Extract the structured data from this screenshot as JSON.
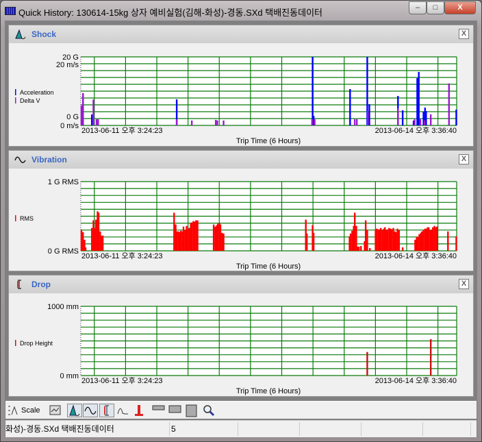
{
  "window": {
    "title": "Quick History: 130614-15kg 상자 예비실험(김해-화성)-경동.SXd 택배진동데이터",
    "minimize": "‒",
    "maximize": "□",
    "close": "X"
  },
  "panels": {
    "shock": {
      "title": "Shock",
      "close": "X",
      "icon": "shock-peak-icon"
    },
    "vibration": {
      "title": "Vibration",
      "close": "X",
      "icon": "sine-wave-icon"
    },
    "drop": {
      "title": "Drop",
      "close": "X",
      "icon": "drop-bracket-icon"
    }
  },
  "toolbar": {
    "scale_label": "Scale"
  },
  "status": {
    "file": "화성)-경동.SXd 택배진동데이터",
    "count": "5"
  },
  "chart_data": [
    {
      "type": "bar",
      "id": "shock",
      "xlabel": "Trip Time (6 Hours)",
      "x_start_label": "2013-06-11 오후 3:24:23",
      "x_end_label": "2013-06-14 오후 3:36:40",
      "xlim_hours": [
        0,
        72.2
      ],
      "grid": true,
      "ticks": [
        {
          "label": "20 G"
        },
        {
          "label": "20 m/s"
        },
        {
          "label": "0 G"
        },
        {
          "label": "0 m/s"
        }
      ],
      "series": [
        {
          "name": "Acceleration",
          "unit": "G",
          "ylim": [
            0,
            20
          ],
          "color": "#0000ff",
          "points": [
            [
              0.4,
              9.4
            ],
            [
              2.1,
              3.2
            ],
            [
              18.4,
              7.6
            ],
            [
              44.5,
              20
            ],
            [
              44.7,
              2.8
            ],
            [
              51.7,
              10.6
            ],
            [
              55.0,
              20
            ],
            [
              55.4,
              6.2
            ],
            [
              60.9,
              8.6
            ],
            [
              61.8,
              4.4
            ],
            [
              63.9,
              1.4
            ],
            [
              64.6,
              13.8
            ],
            [
              64.9,
              15.6
            ],
            [
              65.8,
              4.0
            ],
            [
              66.1,
              5.2
            ],
            [
              66.3,
              4.2
            ],
            [
              72.1,
              4.6
            ]
          ]
        },
        {
          "name": "Delta V",
          "unit": "m/s",
          "ylim": [
            0,
            20
          ],
          "color": "#9a1ad0",
          "points": [
            [
              0.1,
              6.4
            ],
            [
              0.4,
              10.4
            ],
            [
              2.4,
              8.4
            ],
            [
              3.0,
              2.0
            ],
            [
              3.3,
              2.0
            ],
            [
              18.4,
              2.0
            ],
            [
              21.3,
              1.6
            ],
            [
              25.9,
              1.8
            ],
            [
              26.2,
              1.6
            ],
            [
              27.4,
              1.6
            ],
            [
              44.4,
              2.0
            ],
            [
              44.9,
              2.0
            ],
            [
              52.6,
              2.0
            ],
            [
              53.0,
              2.0
            ],
            [
              55.1,
              4.7
            ],
            [
              60.9,
              5.5
            ],
            [
              64.1,
              2.0
            ],
            [
              65.2,
              2.0
            ],
            [
              66.0,
              1.6
            ],
            [
              67.2,
              3.6
            ],
            [
              70.7,
              13.6
            ]
          ]
        }
      ]
    },
    {
      "type": "bar",
      "id": "vibration",
      "xlabel": "Trip Time (6 Hours)",
      "x_start_label": "2013-06-11 오후 3:24:23",
      "x_end_label": "2013-06-14 오후 3:36:40",
      "xlim_hours": [
        0,
        72.2
      ],
      "grid": true,
      "ticks": [
        {
          "label": "1 G RMS"
        },
        {
          "label": "0 G RMS"
        }
      ],
      "series": [
        {
          "name": "RMS",
          "unit": "G RMS",
          "ylim": [
            0,
            1
          ],
          "color": "#ff0000",
          "points": [
            [
              0.1,
              0.3
            ],
            [
              0.4,
              0.27
            ],
            [
              0.7,
              0.16
            ],
            [
              0.9,
              0.05
            ],
            [
              2.1,
              0.33
            ],
            [
              2.4,
              0.44
            ],
            [
              2.6,
              0.33
            ],
            [
              2.9,
              0.45
            ],
            [
              3.2,
              0.57
            ],
            [
              3.4,
              0.55
            ],
            [
              3.7,
              0.28
            ],
            [
              3.9,
              0.22
            ],
            [
              4.2,
              0.22
            ],
            [
              17.9,
              0.55
            ],
            [
              18.2,
              0.38
            ],
            [
              18.4,
              0.28
            ],
            [
              18.7,
              0.28
            ],
            [
              18.9,
              0.27
            ],
            [
              19.2,
              0.29
            ],
            [
              19.5,
              0.28
            ],
            [
              19.7,
              0.35
            ],
            [
              20.0,
              0.3
            ],
            [
              20.3,
              0.36
            ],
            [
              20.5,
              0.31
            ],
            [
              20.8,
              0.33
            ],
            [
              21.1,
              0.4
            ],
            [
              21.3,
              0.41
            ],
            [
              21.6,
              0.43
            ],
            [
              21.8,
              0.42
            ],
            [
              22.1,
              0.44
            ],
            [
              22.4,
              0.44
            ],
            [
              25.5,
              0.38
            ],
            [
              25.8,
              0.35
            ],
            [
              26.1,
              0.37
            ],
            [
              26.3,
              0.39
            ],
            [
              26.6,
              0.4
            ],
            [
              26.8,
              0.38
            ],
            [
              27.1,
              0.26
            ],
            [
              27.4,
              0.25
            ],
            [
              43.2,
              0.45
            ],
            [
              43.4,
              0.25
            ],
            [
              44.5,
              0.37
            ],
            [
              44.7,
              0.26
            ],
            [
              51.6,
              0.21
            ],
            [
              51.8,
              0.25
            ],
            [
              52.1,
              0.29
            ],
            [
              52.4,
              0.36
            ],
            [
              52.6,
              0.55
            ],
            [
              52.9,
              0.36
            ],
            [
              53.2,
              0.06
            ],
            [
              53.4,
              0.06
            ],
            [
              53.8,
              0.07
            ],
            [
              54.5,
              0.14
            ],
            [
              54.7,
              0.44
            ],
            [
              55.0,
              0.3
            ],
            [
              55.5,
              0.04
            ],
            [
              56.6,
              0.3
            ],
            [
              56.8,
              0.32
            ],
            [
              57.1,
              0.31
            ],
            [
              57.4,
              0.31
            ],
            [
              57.6,
              0.33
            ],
            [
              57.9,
              0.3
            ],
            [
              58.2,
              0.32
            ],
            [
              58.4,
              0.34
            ],
            [
              58.7,
              0.3
            ],
            [
              58.9,
              0.31
            ],
            [
              59.2,
              0.33
            ],
            [
              59.5,
              0.32
            ],
            [
              59.7,
              0.31
            ],
            [
              60.0,
              0.33
            ],
            [
              60.3,
              0.28
            ],
            [
              60.5,
              0.27
            ],
            [
              60.8,
              0.32
            ],
            [
              61.1,
              0.3
            ],
            [
              61.8,
              0.05
            ],
            [
              64.2,
              0.16
            ],
            [
              64.5,
              0.2
            ],
            [
              64.7,
              0.2
            ],
            [
              65.0,
              0.24
            ],
            [
              65.3,
              0.26
            ],
            [
              65.5,
              0.28
            ],
            [
              65.8,
              0.3
            ],
            [
              66.1,
              0.32
            ],
            [
              66.3,
              0.32
            ],
            [
              66.6,
              0.34
            ],
            [
              66.8,
              0.34
            ],
            [
              67.1,
              0.3
            ],
            [
              67.4,
              0.3
            ],
            [
              67.6,
              0.34
            ],
            [
              67.9,
              0.36
            ],
            [
              68.2,
              0.34
            ],
            [
              68.4,
              0.35
            ],
            [
              70.5,
              0.28
            ],
            [
              72.1,
              0.21
            ]
          ]
        }
      ]
    },
    {
      "type": "bar",
      "id": "drop",
      "xlabel": "Trip Time (6 Hours)",
      "x_start_label": "2013-06-11 오후 3:24:23",
      "x_end_label": "2013-06-14 오후 3:36:40",
      "xlim_hours": [
        0,
        72.2
      ],
      "grid": true,
      "ticks": [
        {
          "label": "1000 mm"
        },
        {
          "label": "0 mm"
        }
      ],
      "series": [
        {
          "name": "Drop Height",
          "unit": "mm",
          "ylim": [
            0,
            1000
          ],
          "color": "#cc1010",
          "points": [
            [
              55.0,
              340
            ],
            [
              67.2,
              525
            ]
          ]
        }
      ]
    }
  ]
}
